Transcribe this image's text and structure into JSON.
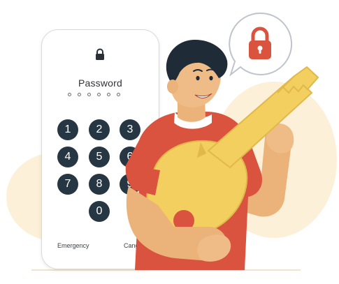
{
  "phone": {
    "title": "Password",
    "pin_length": 6,
    "keys": [
      "1",
      "2",
      "3",
      "4",
      "5",
      "6",
      "7",
      "8",
      "9",
      "0"
    ],
    "emergency_label": "Emergency",
    "cancel_label": "Cancel"
  },
  "icons": {
    "phone_lock": "lock-icon",
    "bubble_lock": "padlock-icon"
  },
  "colors": {
    "keypad": "#263743",
    "lock_red": "#d9533f",
    "key_yellow": "#f2cf5e",
    "shirt_red": "#d9533f",
    "bubble_border": "#bfc4cc"
  }
}
